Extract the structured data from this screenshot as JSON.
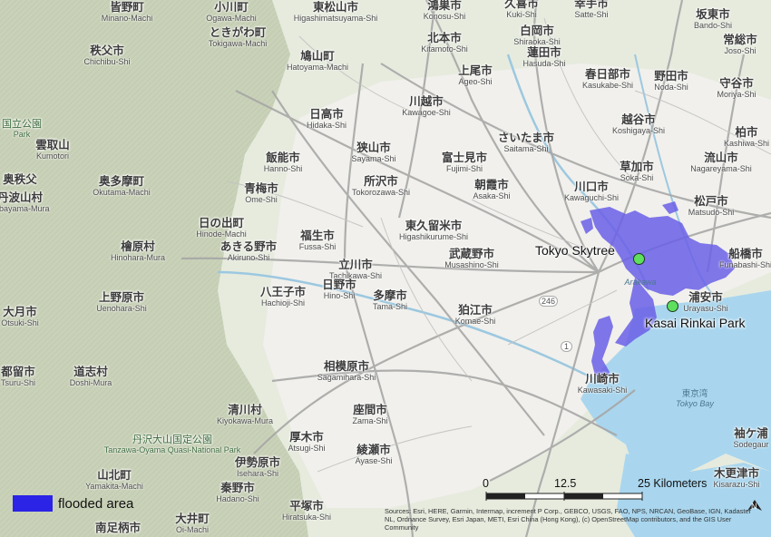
{
  "colors": {
    "terrain": "#e6ebde",
    "mountain": "#c7d0b6",
    "urban": "#f2f1ed",
    "water": "#a9d6ee",
    "road": "#b3b3b3",
    "flood": "#6b60e8",
    "legend_swatch": "#2b23e6",
    "poi_dot": "#5ee05e"
  },
  "places": [
    {
      "jp": "皆野町",
      "en": "Minano-Machi"
    },
    {
      "jp": "小川町",
      "en": "Ogawa-Machi"
    },
    {
      "jp": "東松山市",
      "en": "Higashimatsuyama-Shi"
    },
    {
      "jp": "鴻巣市",
      "en": "Konosu-Shi"
    },
    {
      "jp": "久喜市",
      "en": "Kuki-Shi"
    },
    {
      "jp": "幸手市",
      "en": "Satte-Shi"
    },
    {
      "jp": "坂東市",
      "en": "Bando-Shi"
    },
    {
      "jp": "ときがわ町",
      "en": "Tokigawa-Machi"
    },
    {
      "jp": "白岡市",
      "en": "Shiraoka-Shi"
    },
    {
      "jp": "常総市",
      "en": "Joso-Shi"
    },
    {
      "jp": "秩父市",
      "en": "Chichibu-Shi"
    },
    {
      "jp": "鳩山町",
      "en": "Hatoyama-Machi"
    },
    {
      "jp": "北本市",
      "en": "Kitamoto-Shi"
    },
    {
      "jp": "蓮田市",
      "en": "Hasuda-Shi"
    },
    {
      "jp": "上尾市",
      "en": "Ageo-Shi"
    },
    {
      "jp": "春日部市",
      "en": "Kasukabe-Shi"
    },
    {
      "jp": "野田市",
      "en": "Noda-Shi"
    },
    {
      "jp": "守谷市",
      "en": "Moriya-Shi"
    },
    {
      "jp": "川越市",
      "en": "Kawagoe-Shi"
    },
    {
      "jp": "日高市",
      "en": "Hidaka-Shi"
    },
    {
      "jp": "越谷市",
      "en": "Koshigaya-Shi"
    },
    {
      "jp": "柏市",
      "en": "Kashiwa-Shi"
    },
    {
      "jp": "さいたま市",
      "en": "Saitama-Shi"
    },
    {
      "jp": "狭山市",
      "en": "Sayama-Shi"
    },
    {
      "jp": "飯能市",
      "en": "Hanno-Shi"
    },
    {
      "jp": "富士見市",
      "en": "Fujimi-Shi"
    },
    {
      "jp": "流山市",
      "en": "Nagareyama-Shi"
    },
    {
      "jp": "草加市",
      "en": "Soka-Shi"
    },
    {
      "jp": "所沢市",
      "en": "Tokorozawa-Shi"
    },
    {
      "jp": "朝霞市",
      "en": "Asaka-Shi"
    },
    {
      "jp": "川口市",
      "en": "Kawaguchi-Shi"
    },
    {
      "jp": "奥多摩町",
      "en": "Okutama-Machi"
    },
    {
      "jp": "青梅市",
      "en": "Ome-Shi"
    },
    {
      "jp": "松戸市",
      "en": "Matsudo-Shi"
    },
    {
      "jp": "東久留米市",
      "en": "Higashikurume-Shi"
    },
    {
      "jp": "日の出町",
      "en": "Hinode-Machi"
    },
    {
      "jp": "福生市",
      "en": "Fussa-Shi"
    },
    {
      "jp": "檜原村",
      "en": "Hinohara-Mura"
    },
    {
      "jp": "あきる野市",
      "en": "Akiruno-Shi"
    },
    {
      "jp": "武蔵野市",
      "en": "Musashino-Shi"
    },
    {
      "jp": "船橋市",
      "en": "Funabashi-Shi"
    },
    {
      "jp": "立川市",
      "en": "Tachikawa-Shi"
    },
    {
      "jp": "上野原市",
      "en": "Uenohara-Shi"
    },
    {
      "jp": "八王子市",
      "en": "Hachioji-Shi"
    },
    {
      "jp": "日野市",
      "en": "Hino-Shi"
    },
    {
      "jp": "多摩市",
      "en": "Tama-Shi"
    },
    {
      "jp": "狛江市",
      "en": "Komae-Shi"
    },
    {
      "jp": "浦安市",
      "en": "Urayasu-Shi"
    },
    {
      "jp": "大月市",
      "en": "Otsuki-Shi"
    },
    {
      "jp": "都留市",
      "en": "Tsuru-Shi"
    },
    {
      "jp": "道志村",
      "en": "Doshi-Mura"
    },
    {
      "jp": "相模原市",
      "en": "Sagamihara-Shi"
    },
    {
      "jp": "川崎市",
      "en": "Kawasaki-Shi"
    },
    {
      "jp": "清川村",
      "en": "Kiyokawa-Mura"
    },
    {
      "jp": "座間市",
      "en": "Zama-Shi"
    },
    {
      "jp": "袖ケ浦",
      "en": "Sodegaur"
    },
    {
      "jp": "厚木市",
      "en": "Atsugi-Shi"
    },
    {
      "jp": "綾瀬市",
      "en": "Ayase-Shi"
    },
    {
      "jp": "伊勢原市",
      "en": "Isehara-Shi"
    },
    {
      "jp": "山北町",
      "en": "Yamakita-Machi"
    },
    {
      "jp": "秦野市",
      "en": "Hadano-Shi"
    },
    {
      "jp": "木更津市",
      "en": "Kisarazu-Shi"
    },
    {
      "jp": "平塚市",
      "en": "Hiratsuka-Shi"
    },
    {
      "jp": "大井町",
      "en": "Oi-Machi"
    },
    {
      "jp": "南足柄市",
      "en": ""
    },
    {
      "jp": "奥秩父",
      "en": ""
    },
    {
      "jp": "雲取山",
      "en": "Kumotori"
    },
    {
      "jp": "丹波山村",
      "en": "Tabayama-Mura"
    }
  ],
  "parks": [
    {
      "jp": "丹沢大山国定公園",
      "en": "Tanzawa-Oyama Quasi-National Park"
    },
    {
      "jp": "国立公園",
      "en": "Park"
    }
  ],
  "water_labels": [
    {
      "jp": "東京湾",
      "en": "Tokyo Bay"
    },
    {
      "jp": "",
      "en": "Arakawa"
    }
  ],
  "road_shields": [
    "246",
    "1"
  ],
  "pois": [
    {
      "name": "Tokyo Skytree"
    },
    {
      "name": "Kasai Rinkai Park"
    }
  ],
  "legend": {
    "label": "flooded area"
  },
  "scalebar": {
    "ticks": [
      "0",
      "12.5",
      "25 Kilometers"
    ],
    "segments": 4
  },
  "attribution": "Sources: Esri, HERE, Garmin, Intermap, increment P Corp., GEBCO, USGS, FAO, NPS, NRCAN, GeoBase, IGN, Kadaster NL, Ordnance Survey, Esri Japan, METI, Esri China (Hong Kong), (c) OpenStreetMap contributors, and the GIS User Community",
  "north_label": "N"
}
